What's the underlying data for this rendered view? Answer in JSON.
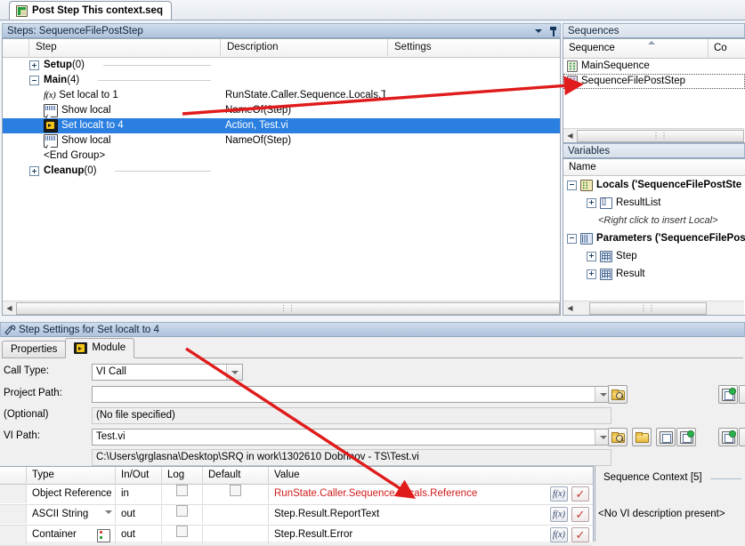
{
  "window": {
    "document_tab": {
      "label": "Post Step This context.seq",
      "icon": "sequence-file-icon"
    }
  },
  "steps_pane": {
    "header": "Steps: SequenceFilePostStep",
    "columns": [
      "Step",
      "Description",
      "Settings"
    ],
    "rows": [
      {
        "kind": "group",
        "expander": "plus",
        "label": "Setup",
        "count": "(0)",
        "desc": "",
        "settings": ""
      },
      {
        "kind": "group",
        "expander": "minus",
        "label": "Main",
        "count": "(4)",
        "desc": "",
        "settings": ""
      },
      {
        "kind": "step",
        "icon": "fx-icon",
        "label": "Set local to 1",
        "desc": "RunState.Caller.Sequence.Locals.T...",
        "settings": "",
        "selected": false
      },
      {
        "kind": "step",
        "icon": "message-popup-icon",
        "label": "Show local",
        "desc": "NameOf(Step)",
        "settings": "",
        "selected": false
      },
      {
        "kind": "step",
        "icon": "labview-vi-icon",
        "label": "Set localt to 4",
        "desc": "Action,  Test.vi",
        "settings": "",
        "selected": true
      },
      {
        "kind": "step",
        "icon": "message-popup-icon",
        "label": "Show local",
        "desc": "NameOf(Step)",
        "settings": "",
        "selected": false
      },
      {
        "kind": "end",
        "label": "<End Group>",
        "desc": "",
        "settings": ""
      },
      {
        "kind": "group",
        "expander": "plus",
        "label": "Cleanup",
        "count": "(0)",
        "desc": "",
        "settings": ""
      }
    ],
    "header_controls": {
      "dropdown": "chevron-down-icon",
      "pin": "pin-icon"
    }
  },
  "sequences_pane": {
    "header": "Sequences",
    "columns": [
      "Sequence",
      "Co"
    ],
    "rows": [
      {
        "label": "MainSequence",
        "icon": "sequence-icon-green",
        "focused": false
      },
      {
        "label": "SequenceFilePostStep",
        "icon": "sequence-icon-purple",
        "focused": true
      }
    ]
  },
  "variables_pane": {
    "header": "Variables",
    "column": "Name",
    "rows": [
      {
        "indent": 0,
        "expander": "minus",
        "icon": "locals-icon",
        "label": "Locals ('SequenceFilePostSte",
        "bold": true
      },
      {
        "indent": 1,
        "expander": "plus",
        "icon": "array-icon",
        "label": "ResultList",
        "bold": false
      },
      {
        "indent": 1,
        "expander": "none",
        "icon": "none",
        "label": "<Right click to insert Local>",
        "italic": true
      },
      {
        "indent": 0,
        "expander": "minus",
        "icon": "parameters-icon",
        "label": "Parameters ('SequenceFilePos",
        "bold": true
      },
      {
        "indent": 1,
        "expander": "plus",
        "icon": "container-icon",
        "label": "Step",
        "bold": false
      },
      {
        "indent": 1,
        "expander": "plus",
        "icon": "container-icon",
        "label": "Result",
        "bold": false
      }
    ]
  },
  "step_settings": {
    "header": "Step Settings for Set localt to 4",
    "tabs": [
      {
        "label": "Properties",
        "active": false,
        "icon": "none"
      },
      {
        "label": "Module",
        "active": true,
        "icon": "labview-vi-icon"
      }
    ],
    "fields": {
      "call_type": {
        "label": "Call Type:",
        "value": "VI Call"
      },
      "project_path": {
        "label": "Project Path:",
        "label2": "(Optional)",
        "value": "",
        "status": "(No file specified)"
      },
      "vi_path": {
        "label": "VI Path:",
        "value": "Test.vi",
        "resolved": "C:\\Users\\grglasna\\Desktop\\SRQ in work\\1302610 Dobrinov - TS\\Test.vi"
      }
    },
    "buttons": [
      "browse-project-icon",
      "browse-vi-icon",
      "new-vi-icon",
      "select-vi-icon",
      "edit-vi-icon",
      "sync-params-icon",
      "sync-params-icon-2"
    ]
  },
  "parameter_table": {
    "columns": [
      "Type",
      "In/Out",
      "Log",
      "Default",
      "Value"
    ],
    "rows": [
      {
        "type": "Object Reference",
        "type_adorn": "none",
        "inout": "in",
        "log": false,
        "default": false,
        "default_shown": true,
        "value": "RunState.Caller.Sequence.Locals.Reference",
        "value_red": true
      },
      {
        "type": "ASCII String",
        "type_adorn": "dropdown",
        "inout": "out",
        "log": false,
        "default": false,
        "default_shown": false,
        "value": "Step.Result.ReportText",
        "value_red": false
      },
      {
        "type": "Container",
        "type_adorn": "container-icon",
        "inout": "out",
        "log": false,
        "default": false,
        "default_shown": false,
        "value": "Step.Result.Error",
        "value_red": false
      }
    ],
    "row_buttons": {
      "expression": "fx-button",
      "confirm": "check-button"
    }
  },
  "sequence_context": {
    "title": "Sequence Context [5]",
    "note": "<No VI description present>"
  },
  "annotations": {
    "arrow_color": "#e01b1b",
    "arrows": [
      {
        "name": "arrow-to-sequence-file-post-step"
      },
      {
        "name": "arrow-to-object-reference-value"
      }
    ]
  }
}
